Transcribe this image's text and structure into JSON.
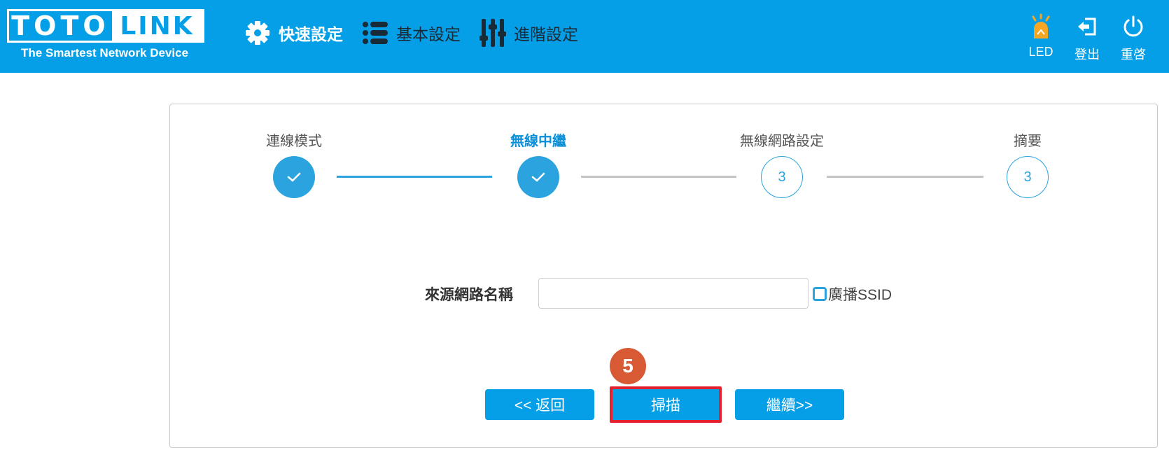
{
  "header": {
    "logo": {
      "left_text": "TOTO",
      "right_text": "LINK",
      "tagline": "The Smartest Network Device"
    },
    "nav": [
      {
        "label": "快速設定",
        "icon": "gear-icon",
        "active": true
      },
      {
        "label": "基本設定",
        "icon": "list-icon",
        "active": false
      },
      {
        "label": "進階設定",
        "icon": "sliders-icon",
        "active": false
      }
    ],
    "tools": [
      {
        "label": "LED",
        "icon": "led-icon"
      },
      {
        "label": "登出",
        "icon": "logout-icon"
      },
      {
        "label": "重啓",
        "icon": "power-icon"
      }
    ],
    "colors": {
      "bar": "#059fe8",
      "led": "#f5a623"
    }
  },
  "wizard": {
    "steps": [
      {
        "label": "連線模式",
        "status": "done"
      },
      {
        "label": "無線中繼",
        "status": "current"
      },
      {
        "label": "無線網路設定",
        "status": "todo",
        "number": "3"
      },
      {
        "label": "摘要",
        "status": "todo",
        "number": "3"
      }
    ],
    "field": {
      "label": "來源網路名稱",
      "value": "",
      "placeholder": ""
    },
    "broadcast": {
      "label": "廣播SSID",
      "checked": false
    },
    "buttons": {
      "back": "<< 返回",
      "scan": "掃描",
      "next": "繼續>>"
    },
    "annotation_badge": "5"
  }
}
